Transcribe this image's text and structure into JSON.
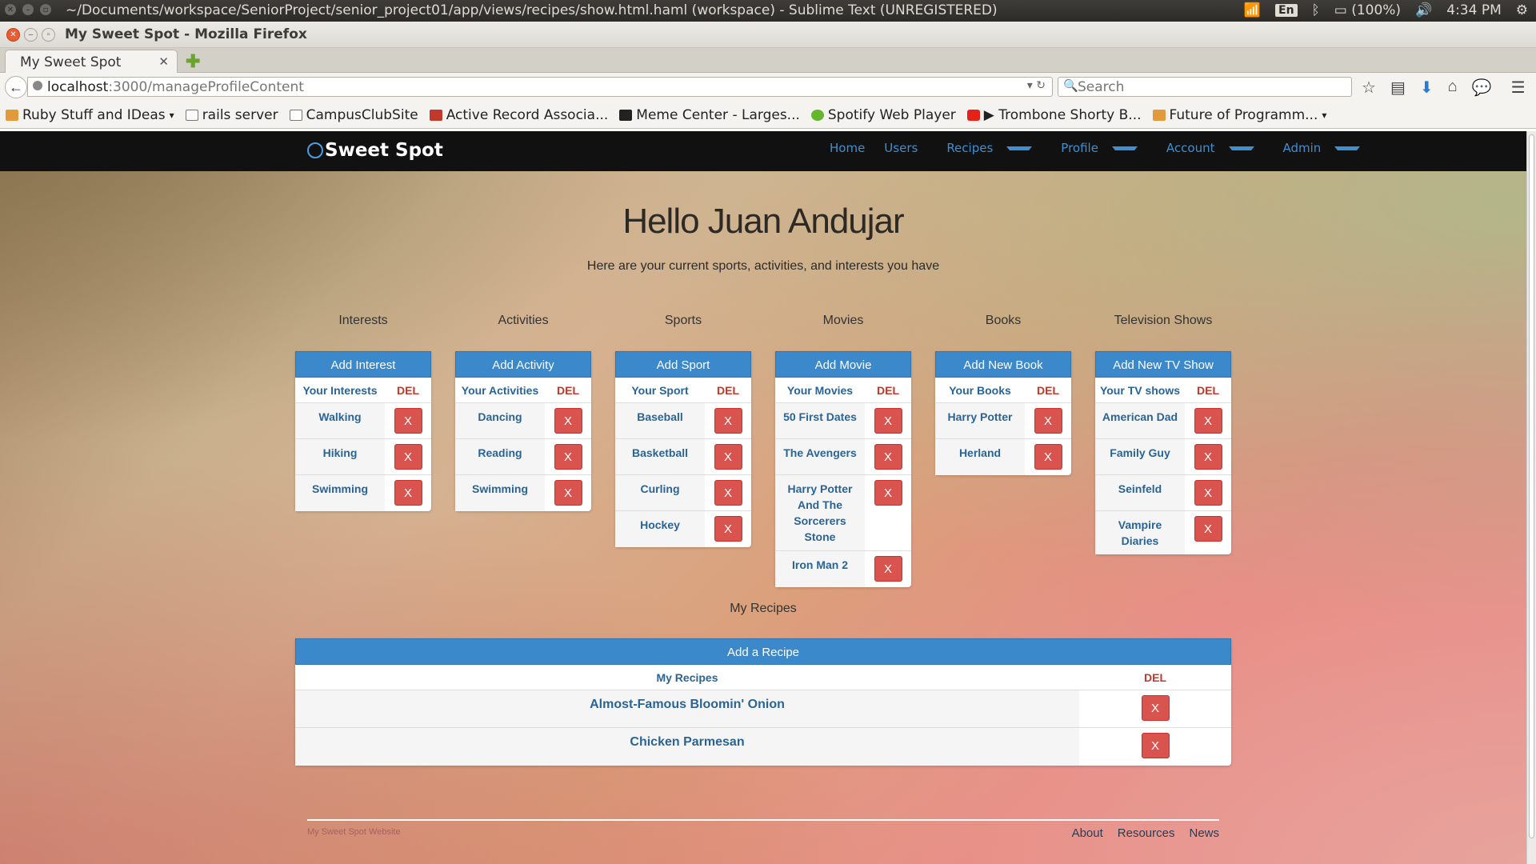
{
  "os": {
    "window_title": "~/Documents/workspace/SeniorProject/senior_project01/app/views/recipes/show.html.haml (workspace) - Sublime Text (UNREGISTERED)",
    "keyboard": "En",
    "battery": "(100%)",
    "clock": "4:34 PM"
  },
  "browser": {
    "window_title": "My Sweet Spot - Mozilla Firefox",
    "tab_title": "My Sweet Spot",
    "url_host": "localhost",
    "url_rest": ":3000/manageProfileContent",
    "search_placeholder": "Search",
    "bookmarks": [
      {
        "label": "Ruby Stuff and IDeas",
        "icon": "folder-icon"
      },
      {
        "label": "rails server",
        "icon": "page-icon"
      },
      {
        "label": "CampusClubSite",
        "icon": "page-icon"
      },
      {
        "label": "Active Record Associa...",
        "icon": "page-icon"
      },
      {
        "label": "Meme Center - Larges...",
        "icon": "memecenter-icon"
      },
      {
        "label": "Spotify Web Player",
        "icon": "spotify-icon"
      },
      {
        "label": "▶ Trombone Shorty B...",
        "icon": "youtube-icon"
      },
      {
        "label": "Future of Programm...",
        "icon": "folder-icon"
      }
    ]
  },
  "site": {
    "brand": "Sweet Spot",
    "nav": [
      "Home",
      "Users",
      "Recipes",
      "Profile",
      "Account",
      "Admin"
    ],
    "greeting": "Hello Juan Andujar",
    "subtitle": "Here are your current sports, activities, and interests you have",
    "del_label": "DEL",
    "x_label": "X",
    "columns": [
      {
        "heading": "Interests",
        "button": "Add Interest",
        "list_header": "Your Interests",
        "items": [
          "Walking",
          "Hiking",
          "Swimming"
        ]
      },
      {
        "heading": "Activities",
        "button": "Add Activity",
        "list_header": "Your Activities",
        "items": [
          "Dancing",
          "Reading",
          "Swimming"
        ]
      },
      {
        "heading": "Sports",
        "button": "Add Sport",
        "list_header": "Your Sport",
        "items": [
          "Baseball",
          "Basketball",
          "Curling",
          "Hockey"
        ]
      },
      {
        "heading": "Movies",
        "button": "Add Movie",
        "list_header": "Your Movies",
        "items": [
          "50 First Dates",
          "The Avengers",
          "Harry Potter And The Sorcerers Stone",
          "Iron Man 2"
        ]
      },
      {
        "heading": "Books",
        "button": "Add New Book",
        "list_header": "Your Books",
        "items": [
          "Harry Potter",
          "Herland"
        ]
      },
      {
        "heading": "Television Shows",
        "button": "Add New TV Show",
        "list_header": "Your TV shows",
        "items": [
          "American Dad",
          "Family Guy",
          "Seinfeld",
          "Vampire Diaries"
        ]
      }
    ],
    "recipes": {
      "heading": "My Recipes",
      "button": "Add a Recipe",
      "list_header": "My Recipes",
      "items": [
        "Almost-Famous Bloomin' Onion",
        "Chicken Parmesan"
      ]
    },
    "footer": {
      "copy": "My Sweet Spot Website",
      "links": [
        "About",
        "Resources",
        "News"
      ]
    }
  }
}
